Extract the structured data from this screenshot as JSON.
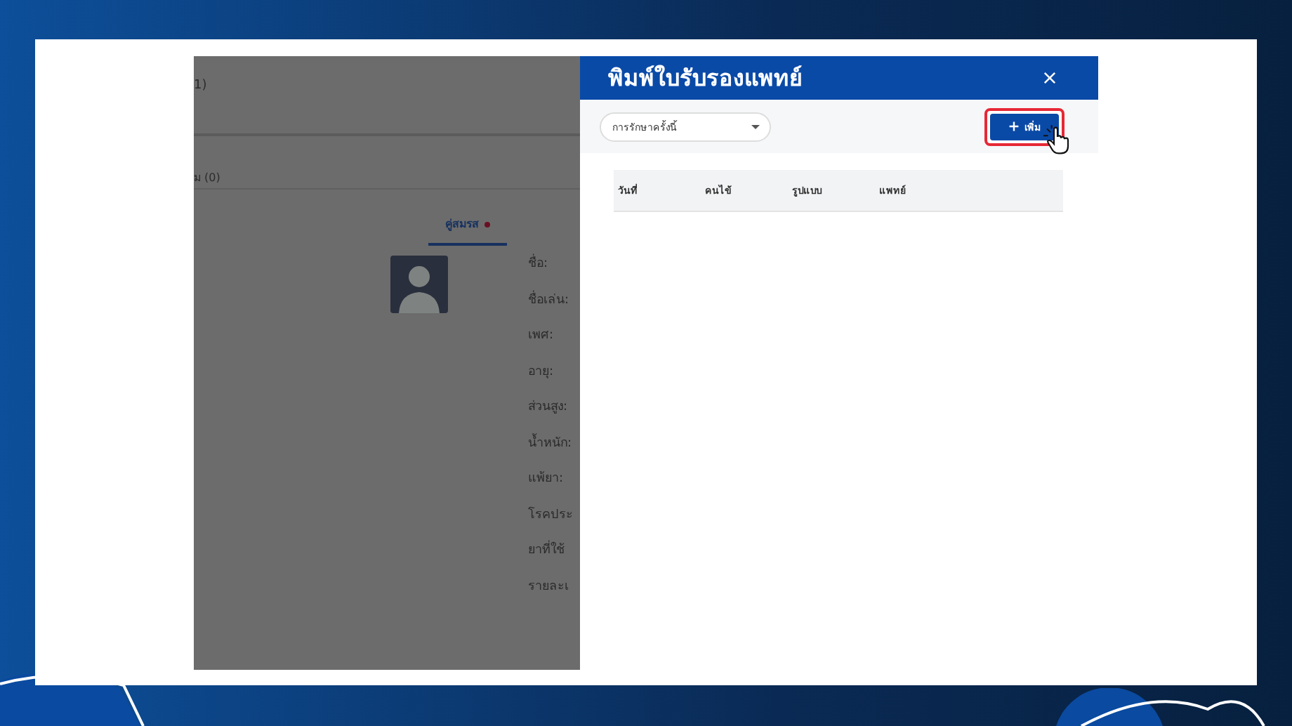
{
  "background_app": {
    "header_fragment": "1)",
    "tab_fragment": "ม (0)",
    "profile_tab": {
      "label": "คู่สมรส",
      "selected": true
    },
    "fields": [
      "ชื่อ:",
      "ชื่อเล่น:",
      "เพศ:",
      "อายุ:",
      "ส่วนสูง:",
      "น้ำหนัก:",
      "แพ้ยา:",
      "โรคประ",
      "ยาที่ใช้",
      "รายละเ"
    ]
  },
  "dialog": {
    "title": "พิมพ์ใบรับรองแพทย์",
    "filter": {
      "value": "การรักษาครั้งนี้"
    },
    "add_button": {
      "label": "เพิ่ม",
      "highlighted": true
    },
    "table": {
      "columns": [
        "วันที่",
        "คนไข้",
        "รูปแบบ",
        "แพทย์"
      ]
    }
  }
}
